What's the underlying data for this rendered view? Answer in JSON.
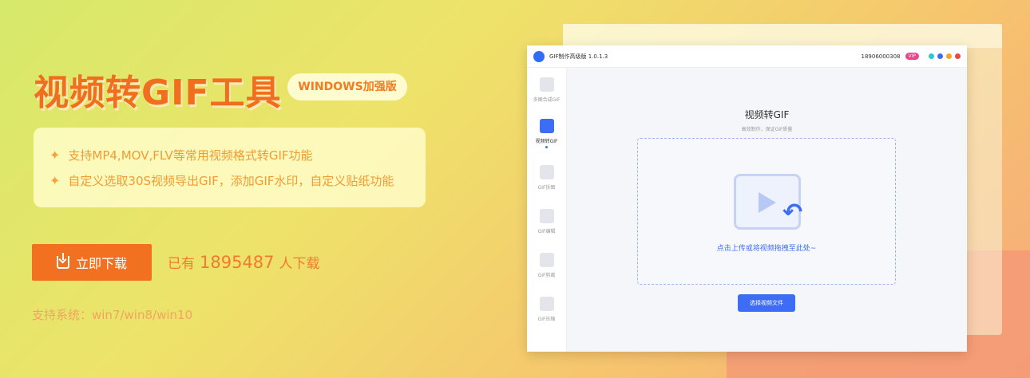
{
  "hero": {
    "title": "视频转GIF工具",
    "badge": "WINDOWS加强版",
    "features": [
      "支持MP4,MOV,FLV等常用视频格式转GIF功能",
      "自定义选取30S视频导出GIF，添加GIF水印，自定义贴纸功能"
    ],
    "download_label": "立即下载",
    "count_prefix": "已有",
    "count_value": "1895487",
    "count_suffix": "人下载",
    "os_support": "支持系统：win7/win8/win10"
  },
  "app": {
    "title": "GIF制作高级版 1.0.1.3",
    "phone": "18906000308",
    "vip": "VIP",
    "sidebar": [
      {
        "label": "多图合成GIF",
        "icon": "image-icon",
        "active": false
      },
      {
        "label": "视频转GIF",
        "icon": "video-icon",
        "active": true
      },
      {
        "label": "GIF拆图",
        "icon": "split-icon",
        "active": false
      },
      {
        "label": "GIF编辑",
        "icon": "edit-icon",
        "active": false
      },
      {
        "label": "GIF剪裁",
        "icon": "crop-icon",
        "active": false
      },
      {
        "label": "GIF压缩",
        "icon": "compress-icon",
        "active": false
      }
    ],
    "main_title": "视频转GIF",
    "main_subtitle": "高效制作，保证GIF质量",
    "drop_text": "点击上传或将视频拖拽至此处~",
    "choose_button": "选择视频文件",
    "colors": {
      "accent": "#3d6df5",
      "vip": "#e8458a"
    }
  }
}
